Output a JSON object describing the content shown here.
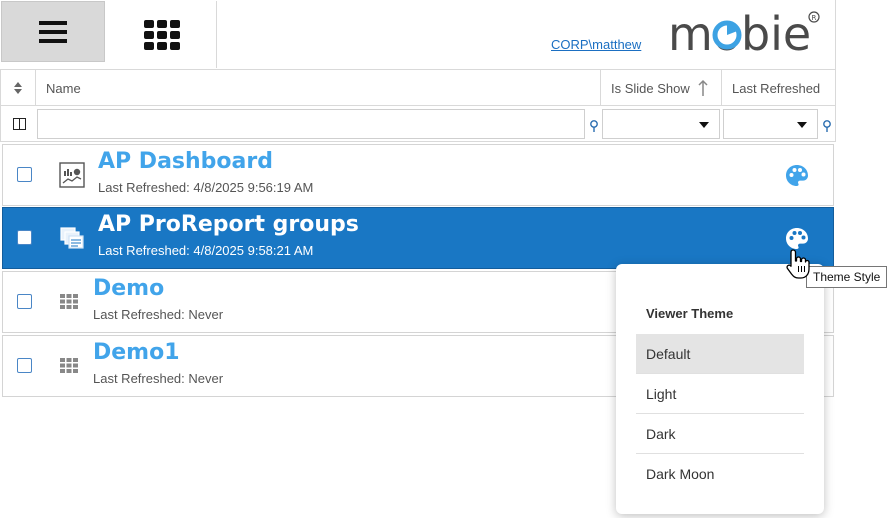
{
  "header": {
    "user": "CORP\\matthew",
    "logo_text": "mobie"
  },
  "columns": {
    "name": "Name",
    "slide_show": "Is Slide Show",
    "last_refreshed": "Last Refreshed"
  },
  "rows": [
    {
      "title": "AP Dashboard",
      "subtitle": "Last Refreshed: 4/8/2025 9:56:19 AM"
    },
    {
      "title": "AP ProReport groups",
      "subtitle": "Last Refreshed: 4/8/2025 9:58:21 AM"
    },
    {
      "title": "Demo",
      "subtitle": "Last Refreshed: Never"
    },
    {
      "title": "Demo1",
      "subtitle": "Last Refreshed: Never"
    }
  ],
  "tooltip": "Theme Style",
  "theme_menu": {
    "title": "Viewer Theme",
    "options": [
      "Default",
      "Light",
      "Dark",
      "Dark Moon"
    ],
    "selected": "Default"
  },
  "colors": {
    "accent": "#1977c4",
    "title_blue": "#41a4ea"
  }
}
